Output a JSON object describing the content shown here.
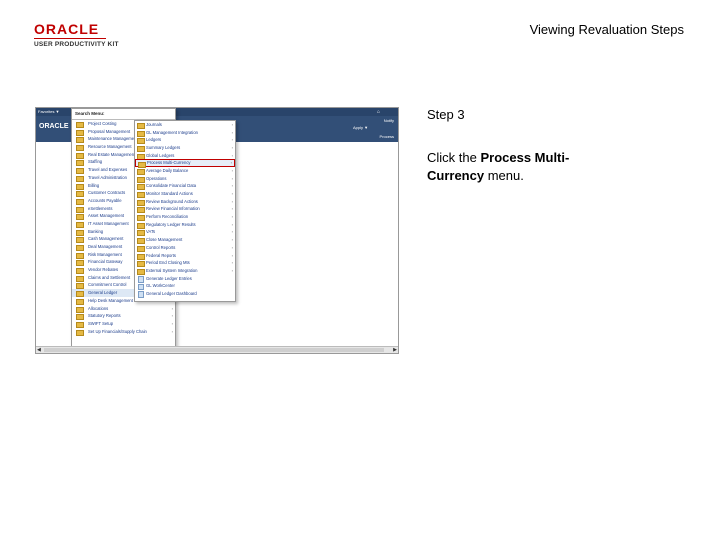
{
  "logo": {
    "brand": "ORACLE",
    "product": "USER PRODUCTIVITY KIT"
  },
  "page_title": "Viewing Revaluation Steps",
  "step_label": "Step 3",
  "instruction": {
    "before": "Click the ",
    "target": "Process Multi-Currency",
    "after": " menu."
  },
  "screenshot": {
    "topbar": {
      "favorites": "Favorites ▼",
      "main_menu": "Main Menu ▼",
      "home_icon": "home-icon"
    },
    "banner": {
      "brand": "ORACLE",
      "apply": "Apply ▼",
      "notify": "Notify",
      "process": "Process"
    },
    "search_menu": {
      "header": "Search Menu:",
      "items": [
        "Project Costing",
        "Proposal Management",
        "Maintenance Management",
        "Resource Management",
        "Real Estate Management",
        "Staffing",
        "Travel and Expenses",
        "Travel Administration",
        "Billing",
        "Customer Contracts",
        "Accounts Payable",
        "eSettlements",
        "Asset Management",
        "IT Asset Management",
        "Banking",
        "Cash Management",
        "Deal Management",
        "Risk Management",
        "Financial Gateway",
        "Vendor Rebates",
        "Claims and Settlement",
        "Commitment Control",
        "General Ledger",
        "Help Desk Management",
        "Allocations",
        "Statutory Reports",
        "SWIFT Setup",
        "Set Up Financials/Supply Chain"
      ]
    },
    "submenu": {
      "items": [
        "Journals",
        "GL Management Integration",
        "Ledgers",
        "Summary Ledgers",
        "Global Ledgers",
        "Process Multi-Currency",
        "Average Daily Balance",
        "Operations",
        "Consolidate Financial Data",
        "Monitor Standard Actions",
        "Review Background Actions",
        "Review Financial Information",
        "Perform Reconciliation",
        "Regulatory Ledger Results",
        "VATs",
        "Close Management",
        "Control Reports",
        "Federal Reports",
        "Period End Closing Mts",
        "External System Integration",
        "Generate Ledger Entries",
        "GL WorkCenter",
        "General Ledger Dashboard"
      ]
    }
  }
}
